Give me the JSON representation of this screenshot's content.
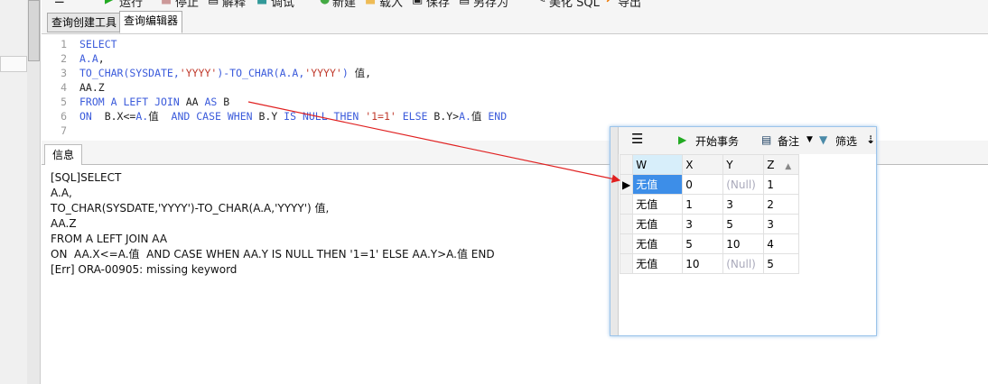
{
  "toolbar": {
    "run": "运行",
    "stop": "停止",
    "explain": "解释",
    "debug": "调试",
    "new": "新建",
    "load": "载入",
    "save": "保存",
    "save_as": "另存为",
    "beautify": "美化 SQL",
    "export": "导出"
  },
  "tabs": [
    {
      "label": "查询创建工具"
    },
    {
      "label": "查询编辑器"
    }
  ],
  "editor": {
    "lines": [
      "1",
      "2",
      "3",
      "4",
      "5",
      "6",
      "7"
    ]
  },
  "info": {
    "tab": "信息",
    "lines": [
      "[SQL]SELECT",
      "A.A,",
      "TO_CHAR(SYSDATE,'YYYY')-TO_CHAR(A.A,'YYYY') 值,",
      "AA.Z",
      "FROM A LEFT JOIN AA",
      "ON  AA.X<=A.值  AND CASE WHEN AA.Y IS NULL THEN '1=1' ELSE AA.Y>A.值 END",
      "[Err] ORA-00905: missing keyword"
    ]
  },
  "popup": {
    "begin_tx": "开始事务",
    "note": "备注",
    "filter": "筛选",
    "columns": [
      "W",
      "X",
      "Y",
      "Z"
    ],
    "rows": [
      [
        "无值",
        "0",
        "(Null)",
        "1"
      ],
      [
        "无值",
        "1",
        "3",
        "2"
      ],
      [
        "无值",
        "3",
        "5",
        "3"
      ],
      [
        "无值",
        "5",
        "10",
        "4"
      ],
      [
        "无值",
        "10",
        "(Null)",
        "5"
      ]
    ]
  },
  "colors": {
    "keyword": "#3b5bdb",
    "string": "#c0392b",
    "arrow": "#e02020"
  }
}
